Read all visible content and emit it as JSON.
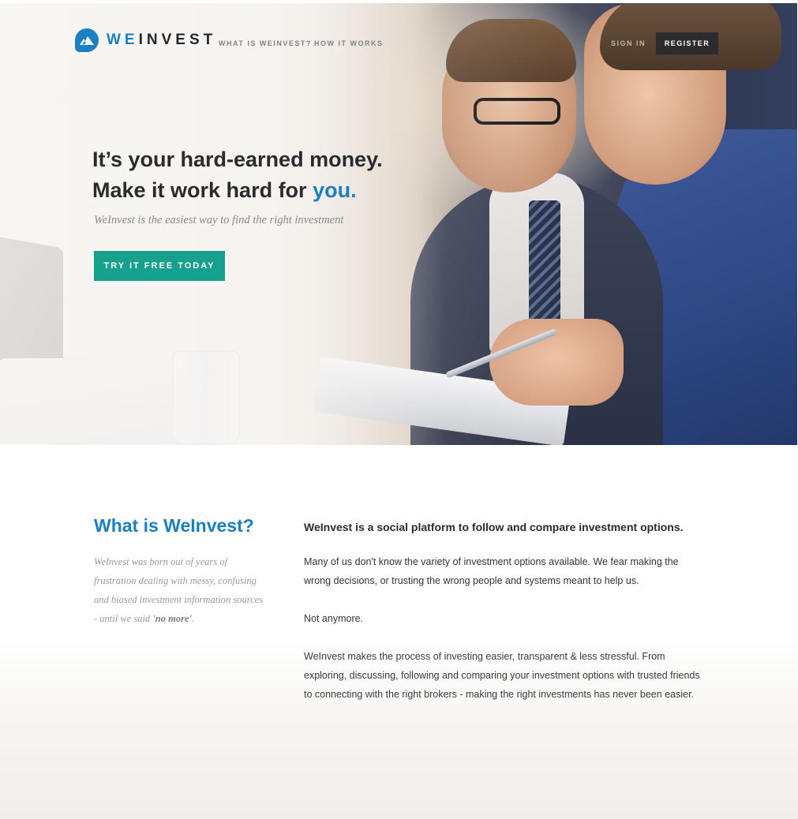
{
  "nav": {
    "logo_we": "WE",
    "logo_invest": "INVEST",
    "links": [
      "WHAT IS WEINVEST?",
      "HOW IT WORKS"
    ],
    "sign_in": "SIGN IN",
    "register": "REGISTER"
  },
  "hero": {
    "headline_line1": "It’s your hard-earned money.",
    "headline_line2": "Make it work hard for ",
    "headline_accent": "you.",
    "tagline": "WeInvest is the easiest way to find the right investment",
    "cta": "TRY IT FREE TODAY"
  },
  "about": {
    "title": "What is WeInvest?",
    "intro": "WeInvest was born out of years of frustration dealing with messy, confusing and biased investment information sources - until we said ",
    "intro_bold": "'no more'",
    "intro_end": ".",
    "lead": "WeInvest is a social platform to follow and compare investment options.",
    "p1": "Many of us don't know the variety of investment options available. We fear making the wrong decisions, or trusting the wrong people and systems meant to help us.",
    "p2": "Not anymore.",
    "p3": "WeInvest makes the process of investing easier, transparent & less stressful. From exploring, discussing, following and comparing your investment options with trusted friends to connecting with the right brokers -  making the right investments has never been easier."
  },
  "colors": {
    "brand_blue": "#1b7fc1",
    "cta_teal": "#16a08e",
    "register_dark": "#2c2c2e"
  },
  "icons": {
    "logo": "mountain-logo-icon"
  }
}
